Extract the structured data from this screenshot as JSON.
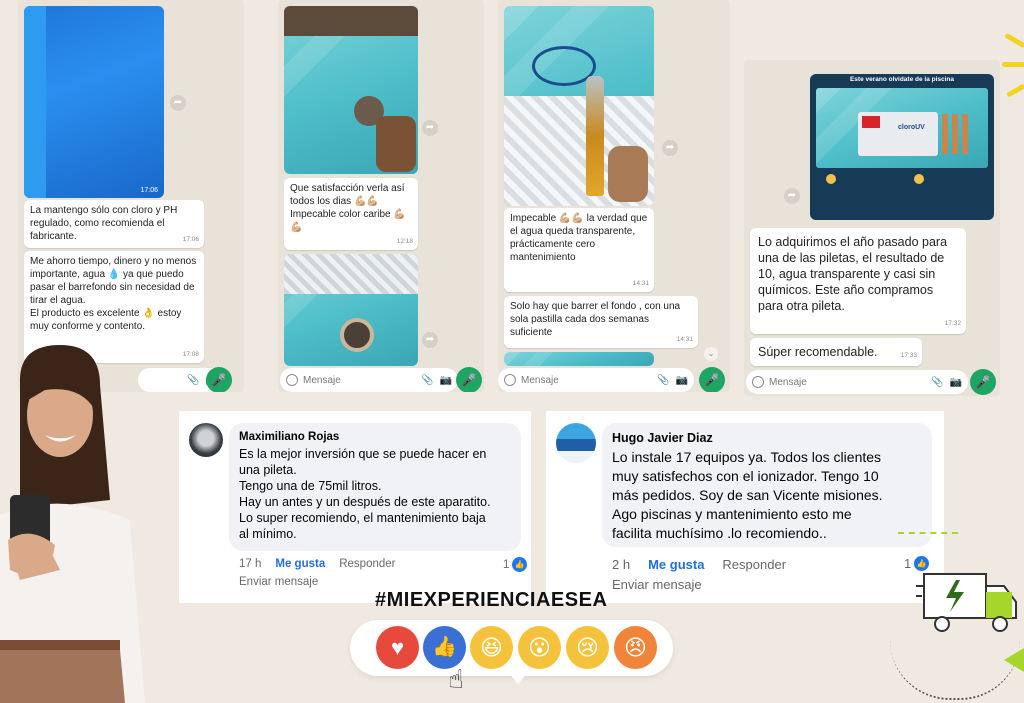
{
  "panels": [
    {
      "photo_time": "17:06",
      "bubbles": [
        {
          "text": "La mantengo sólo con cloro y PH regulado, como recomienda el fabricante.",
          "time": "17:06"
        },
        {
          "text1": "Me ahorro tiempo, dinero y no menos importante, agua ",
          "emoji1": "💧",
          "text2": " ya que puedo pasar el barrefondo sin necesidad de tirar el agua.",
          "text3": "El producto es excelente ",
          "emoji3": "👌",
          "text4": " estoy muy conforme y contento.",
          "time": "17:08"
        }
      ]
    },
    {
      "bubbles": [
        {
          "text": "Que satisfacción verla así todos los dias ",
          "emoji": "💪🏼💪🏼",
          "text2": " Impecable color caribe ",
          "emoji2": "💪🏼💪🏼",
          "time": "12:18"
        }
      ],
      "input_placeholder": "Mensaje"
    },
    {
      "bubbles": [
        {
          "text": "Impecable ",
          "emoji": "💪🏼💪🏼",
          "text2": " la verdad que el agua queda transparente, prácticamente cero mantenimiento",
          "time": "14:31"
        },
        {
          "text": "Solo hay que barrer el fondo , con una sola pastilla cada dos semanas suficiente",
          "time": "14:31"
        }
      ],
      "input_placeholder": "Mensaje"
    },
    {
      "photo_caption": "Este verano olvidate de la piscina",
      "photo_brand": "cloroUV",
      "bubbles": [
        {
          "text": "Lo adquirimos el año pasado para una de las piletas, el resultado de 10, agua transparente y casi sin químicos. Este año compramos para otra pileta.",
          "time": "17:32"
        },
        {
          "text": "Súper recomendable.",
          "time": "17:33"
        }
      ],
      "input_placeholder": "Mensaje"
    }
  ],
  "comments": [
    {
      "name": "Maximiliano Rojas",
      "lines": [
        "Es la mejor inversión que se puede hacer en",
        "una pileta.",
        "Tengo una de 75mil litros.",
        "Hay un antes y un después de este aparatito.",
        "Lo super recomiendo, el mantenimiento baja",
        "al mínimo."
      ],
      "age": "17 h",
      "like": "Me gusta",
      "reply": "Responder",
      "count": "1",
      "send": "Enviar mensaje"
    },
    {
      "name": "Hugo Javier Diaz",
      "lines": [
        "Lo instale 17 equipos  ya. Todos los clientes",
        "muy satisfechos con el ionizador. Tengo 10",
        "más pedidos. Soy  de san Vicente misiones.",
        "Ago piscinas y mantenimiento esto me",
        "facilita muchísimo  .lo recomiendo.."
      ],
      "age": "2 h",
      "like": "Me gusta",
      "reply": "Responder",
      "count": "1",
      "send": "Enviar mensaje"
    }
  ],
  "hashtag": "#MIEXPERIENCIAESEA",
  "reactions": [
    {
      "name": "love",
      "glyph": "♥",
      "color": "#e8493d"
    },
    {
      "name": "like",
      "glyph": "👍",
      "color": "#3b6fd4"
    },
    {
      "name": "haha",
      "glyph": "😆",
      "color": "#f5c33b"
    },
    {
      "name": "wow",
      "glyph": "😮",
      "color": "#f5c33b"
    },
    {
      "name": "sad",
      "glyph": "😢",
      "color": "#f5c33b"
    },
    {
      "name": "angry",
      "glyph": "😠",
      "color": "#f0843a"
    }
  ],
  "colors": {
    "background": "#efe9e1",
    "whatsapp_green": "#1ea563",
    "facebook_blue": "#1877f2",
    "accent_yellow": "#f3d322",
    "accent_green": "#a6d62b"
  }
}
